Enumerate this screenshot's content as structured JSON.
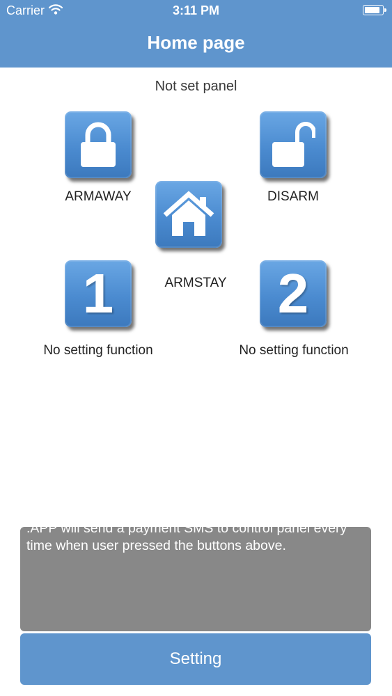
{
  "status_bar": {
    "carrier": "Carrier",
    "time": "3:11 PM",
    "battery_percent": 95
  },
  "nav": {
    "title": "Home page"
  },
  "panel_status": "Not set panel",
  "buttons": {
    "armaway": {
      "label": "ARMAWAY",
      "icon": "lock-closed-icon"
    },
    "disarm": {
      "label": "DISARM",
      "icon": "lock-open-icon"
    },
    "armstay": {
      "label": "ARMSTAY",
      "icon": "house-icon"
    },
    "button1": {
      "digit": "1",
      "label": "No setting function"
    },
    "button2": {
      "digit": "2",
      "label": "No setting function"
    }
  },
  "tips": {
    "text": "Tips: Press the buttons to arm, disarm or stay-arm the control panel above.The functions of the button 1 and button 2 could be changed in the setting option.Warm Tips:Making sure that APP SMS permission is allowed .APP will send a payment SMS to control panel every time when user pressed the buttons above."
  },
  "setting_button": {
    "label": "Setting"
  },
  "colors": {
    "accent": "#5f95cd",
    "tile": "#4b8bd0",
    "tips_background": "#888888"
  }
}
